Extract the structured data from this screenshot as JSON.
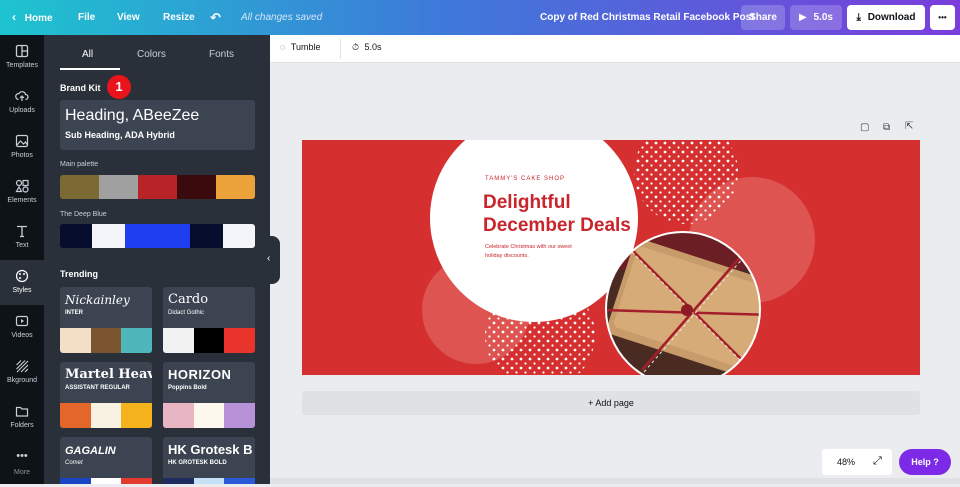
{
  "topbar": {
    "home": "Home",
    "file": "File",
    "view": "View",
    "resize": "Resize",
    "saved_status": "All changes saved",
    "doc_title": "Copy of Red Christmas Retail Facebook Post",
    "share": "Share",
    "play_duration": "5.0s",
    "download": "Download",
    "more": "•••"
  },
  "leftnav": {
    "items": [
      {
        "label": "Templates",
        "icon": "templates-icon"
      },
      {
        "label": "Uploads",
        "icon": "uploads-icon"
      },
      {
        "label": "Photos",
        "icon": "photos-icon"
      },
      {
        "label": "Elements",
        "icon": "elements-icon"
      },
      {
        "label": "Text",
        "icon": "text-icon"
      },
      {
        "label": "Styles",
        "icon": "styles-icon"
      },
      {
        "label": "Videos",
        "icon": "videos-icon"
      },
      {
        "label": "Bkground",
        "icon": "background-icon"
      },
      {
        "label": "Folders",
        "icon": "folders-icon"
      },
      {
        "label": "More",
        "icon": "more-icon"
      }
    ]
  },
  "panel": {
    "tabs": [
      "All",
      "Colors",
      "Fonts"
    ],
    "brand_kit_label": "Brand Kit",
    "step_badge": "1",
    "font_heading": "Heading, ABeeZee",
    "font_subheading": "Sub Heading, ADA Hybrid",
    "main_palette_label": "Main palette",
    "main_palette": [
      "#7b6a34",
      "#a0a0a0",
      "#b82327",
      "#3a0a0c",
      "#eba238"
    ],
    "deep_blue_label": "The Deep Blue",
    "deep_blue_palette": [
      "#070d2c",
      "#f4f5fb",
      "#1e3ef0",
      "#070d2c",
      "#f4f5fb"
    ],
    "trending_label": "Trending",
    "trending": [
      {
        "title": "Nickainley",
        "subtitle": "INTER",
        "colors": [
          "#f2dfc6",
          "#7b5530",
          "#4fb6bc"
        ]
      },
      {
        "title": "Cardo",
        "subtitle": "Didact Gothic",
        "colors": [
          "#f2f2f2",
          "#000000",
          "#e8342a"
        ]
      },
      {
        "title": "Martel Heav",
        "subtitle": "ASSISTANT REGULAR",
        "colors": [
          "#e3662a",
          "#f7f2e1",
          "#f4b31c"
        ]
      },
      {
        "title": "HORIZON",
        "subtitle": "Poppins Bold",
        "colors": [
          "#e8b5c2",
          "#fdf8ee",
          "#b792d8"
        ]
      },
      {
        "title": "GAGALIN",
        "subtitle": "Comet",
        "colors": [
          "#1945c4",
          "#ffffff",
          "#e23a2f"
        ]
      },
      {
        "title": "HK Grotesk B",
        "subtitle": "HK GROTESK BOLD",
        "colors": [
          "#1d2b5f",
          "#c4e1f6",
          "#2b5ad8"
        ]
      }
    ]
  },
  "toolbar2": {
    "animation": "Tumble",
    "duration": "5.0s"
  },
  "design": {
    "shop_name": "TAMMY'S CAKE SHOP",
    "headline_line1": "Delightful",
    "headline_line2": "December Deals",
    "body_line1": "Celebrate Christmas with our sweet",
    "body_line2": "holiday discounts."
  },
  "add_page": "+ Add page",
  "zoom": "48%",
  "help": "Help ?",
  "colors": {
    "accent_gradient_start": "#1ec4cf",
    "accent_gradient_end": "#7a3ddc",
    "canvas_red": "#d62f30",
    "headline_red": "#c8262c",
    "help_purple": "#7d2ae8"
  }
}
